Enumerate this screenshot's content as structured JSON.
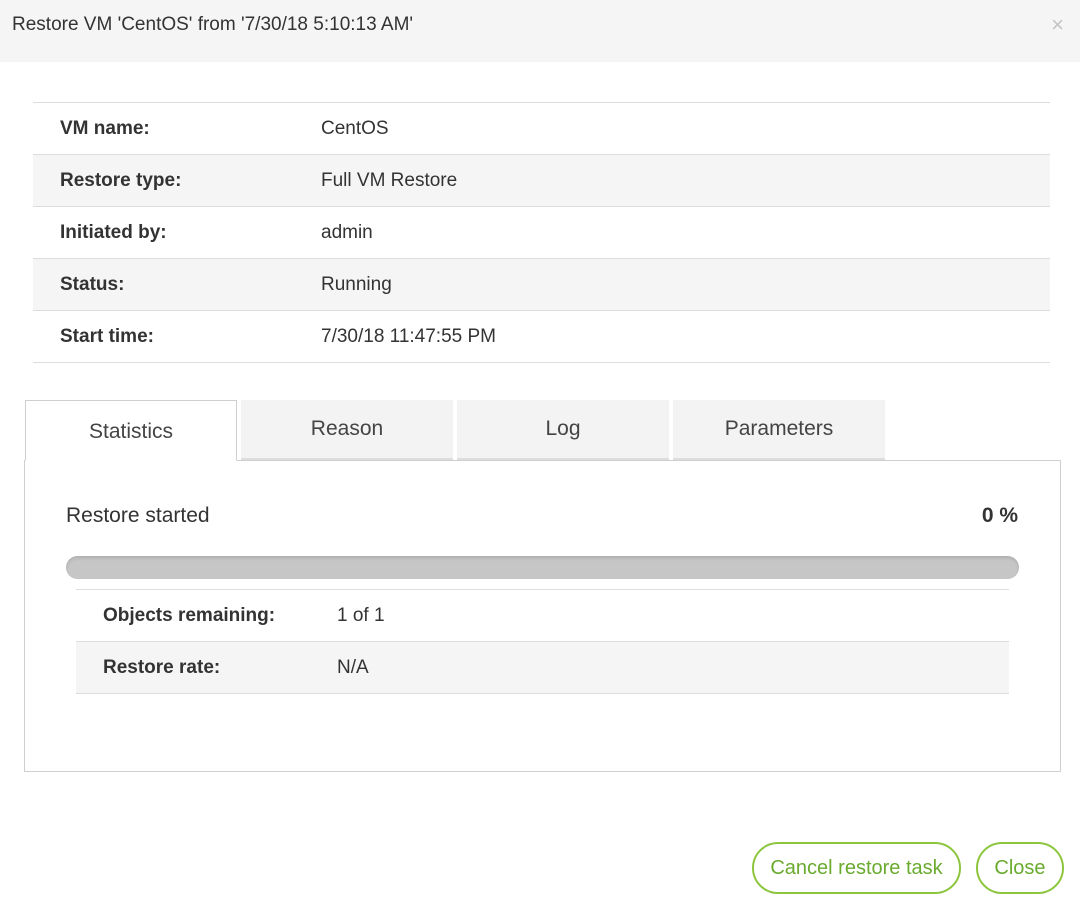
{
  "dialog": {
    "title": "Restore VM 'CentOS' from '7/30/18 5:10:13 AM'",
    "close_glyph": "×"
  },
  "info": [
    {
      "label": "VM name:",
      "value": "CentOS"
    },
    {
      "label": "Restore type:",
      "value": "Full VM Restore"
    },
    {
      "label": "Initiated by:",
      "value": "admin"
    },
    {
      "label": "Status:",
      "value": "Running"
    },
    {
      "label": "Start time:",
      "value": "7/30/18 11:47:55 PM"
    }
  ],
  "tabs": [
    {
      "label": "Statistics",
      "active": true
    },
    {
      "label": "Reason",
      "active": false
    },
    {
      "label": "Log",
      "active": false
    },
    {
      "label": "Parameters",
      "active": false
    }
  ],
  "statistics": {
    "progress_label": "Restore started",
    "progress_text": "0 %",
    "progress_value": 0,
    "rows": [
      {
        "label": "Objects remaining:",
        "value": "1 of 1"
      },
      {
        "label": "Restore rate:",
        "value": "N/A"
      }
    ]
  },
  "buttons": {
    "cancel": "Cancel restore task",
    "close": "Close"
  },
  "colors": {
    "accent": "#8cc63f",
    "accent_text": "#6aab2e",
    "progress_track": "#c6c6c6",
    "header_bg": "#f5f5f5"
  }
}
